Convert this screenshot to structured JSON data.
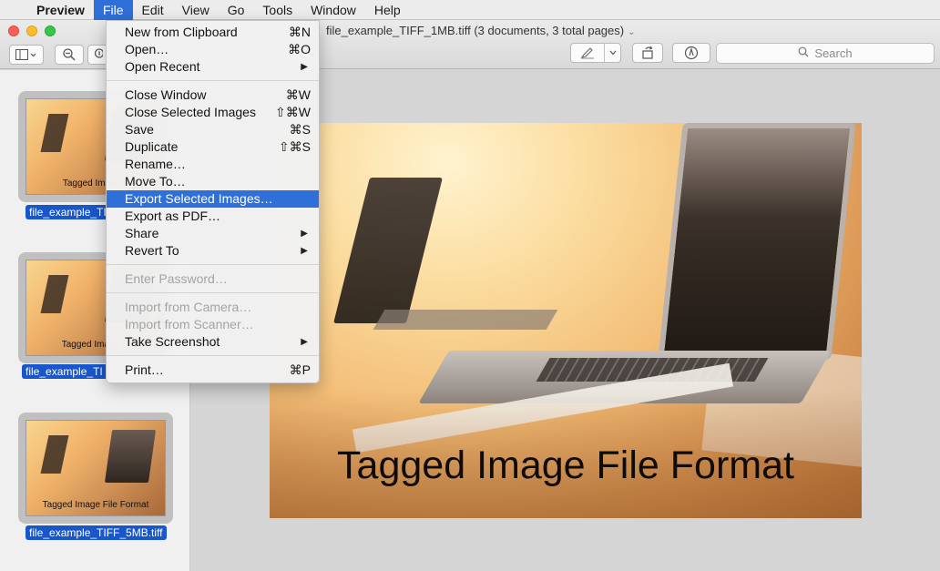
{
  "menubar": {
    "apple": "",
    "app": "Preview",
    "items": [
      "File",
      "Edit",
      "View",
      "Go",
      "Tools",
      "Window",
      "Help"
    ]
  },
  "window": {
    "title": "file_example_TIFF_1MB.tiff (3 documents, 3 total pages)",
    "search_placeholder": "Search"
  },
  "sidebar": {
    "thumbs": [
      {
        "caption": "Tagged Image F",
        "filename": "file_example_TI"
      },
      {
        "caption": "Tagged Image Fi",
        "filename": "file_example_TI"
      },
      {
        "caption": "Tagged Image File Format",
        "filename": "file_example_TIFF_5MB.tiff"
      }
    ]
  },
  "viewer": {
    "image_caption": "Tagged Image File Format"
  },
  "file_menu": {
    "items": [
      {
        "label": "New from Clipboard",
        "shortcut": "⌘N"
      },
      {
        "label": "Open…",
        "shortcut": "⌘O"
      },
      {
        "label": "Open Recent",
        "shortcut": "▶"
      },
      {
        "label": "Close Window",
        "shortcut": "⌘W"
      },
      {
        "label": "Close Selected Images",
        "shortcut": "⇧⌘W"
      },
      {
        "label": "Save",
        "shortcut": "⌘S"
      },
      {
        "label": "Duplicate",
        "shortcut": "⇧⌘S"
      },
      {
        "label": "Rename…",
        "shortcut": ""
      },
      {
        "label": "Move To…",
        "shortcut": ""
      },
      {
        "label": "Export Selected Images…",
        "shortcut": ""
      },
      {
        "label": "Export as PDF…",
        "shortcut": ""
      },
      {
        "label": "Share",
        "shortcut": "▶"
      },
      {
        "label": "Revert To",
        "shortcut": "▶"
      },
      {
        "label": "Enter Password…",
        "shortcut": ""
      },
      {
        "label": "Import from Camera…",
        "shortcut": ""
      },
      {
        "label": "Import from Scanner…",
        "shortcut": ""
      },
      {
        "label": "Take Screenshot",
        "shortcut": "▶"
      },
      {
        "label": "Print…",
        "shortcut": "⌘P"
      }
    ]
  },
  "colors": {
    "highlight": "#2f6fd8",
    "selection": "#1856c9"
  }
}
